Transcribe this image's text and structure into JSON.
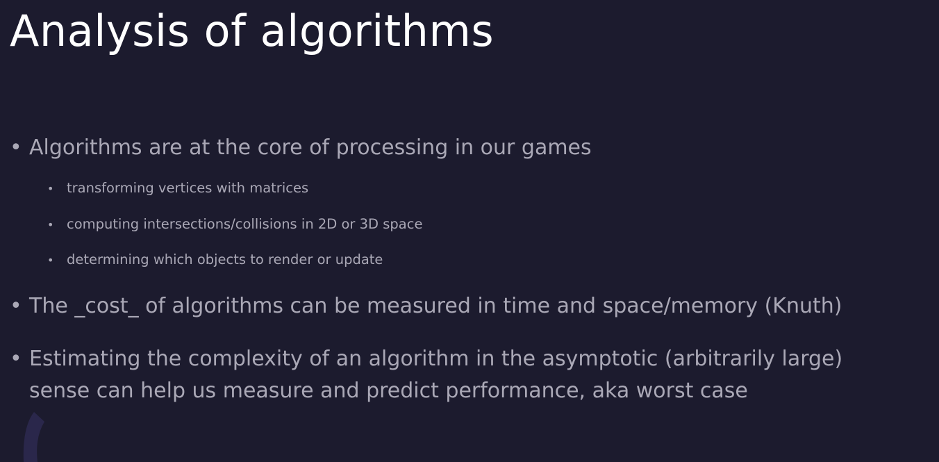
{
  "slide": {
    "title": "Analysis of algorithms",
    "bullet_glyph": "•",
    "bullets": [
      {
        "text": "Algorithms are at the core of processing in our games",
        "sub": [
          "transforming vertices with matrices",
          "computing intersections/collisions in 2D or 3D space",
          "determining which objects to render or update"
        ]
      },
      {
        "text": "The _cost_ of algorithms can be measured in time and space/memory (Knuth)"
      },
      {
        "text_line1": "Estimating the complexity of an algorithm in the asymptotic (arbitrarily large)",
        "text_line2": "sense can help us measure and predict performance, aka worst case"
      }
    ]
  },
  "colors": {
    "background": "#1c1b2e",
    "title": "#ffffff",
    "body": "#aaa8b6",
    "decoration": "#2e2a52"
  }
}
